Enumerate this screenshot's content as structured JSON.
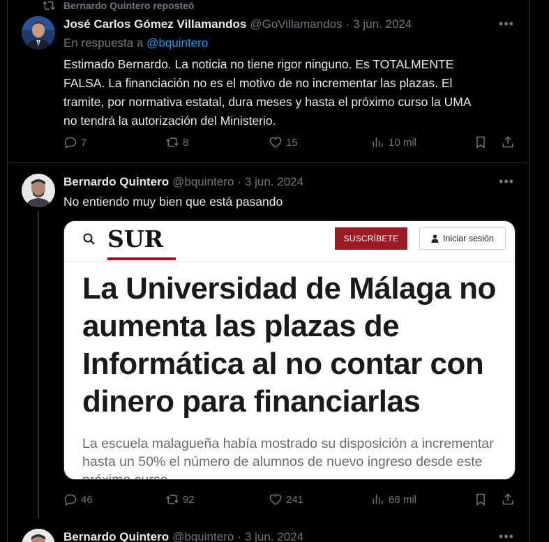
{
  "repost": {
    "label": "Bernardo Quintero reposteó"
  },
  "tweet1": {
    "name": "José Carlos Gómez Villamandos",
    "handle": "@GoVillamandos",
    "date": "3 jun. 2024",
    "reply_prefix": "En respuesta a",
    "reply_handle": "@bquintero",
    "text_lines": [
      "Estimado Bernardo. La noticia no tiene rigor ninguno. Es TOTALMENTE",
      "FALSA. La financiación no es el motivo de no incrementar las plazas. El",
      "tramite, por normativa estatal, dura meses y hasta el próximo curso la UMA",
      "no tendrá la autorización del Ministerio."
    ],
    "replies": "7",
    "reposts": "8",
    "likes": "15",
    "views": "10 mil"
  },
  "tweet2": {
    "name": "Bernardo Quintero",
    "handle": "@bquintero",
    "date": "3 jun. 2024",
    "text": "No entiendo muy bien que está pasando",
    "card": {
      "logo": "SUR",
      "subscribe_label": "SUSCRÍBETE",
      "login_label": "Iniciar sesión",
      "headline_lines": [
        "La Universidad de Málaga no",
        "aumenta las plazas de",
        "Informática al no contar con",
        "dinero para financiarlas"
      ],
      "subhead_lines": [
        "La escuela malagueña había mostrado su disposición a incrementar",
        "hasta un 50% el número de alumnos de nuevo ingreso desde este",
        "próximo curso"
      ]
    },
    "replies": "46",
    "reposts": "92",
    "likes": "241",
    "views": "68 mil"
  },
  "tweet3": {
    "name": "Bernardo Quintero",
    "handle": "@bquintero",
    "date": "3 jun. 2024"
  },
  "colors": {
    "background": "#000000",
    "text": "#e7e9ea",
    "muted": "#71767b",
    "link": "#1d9bf0",
    "sur_red": "#b10f1c"
  }
}
